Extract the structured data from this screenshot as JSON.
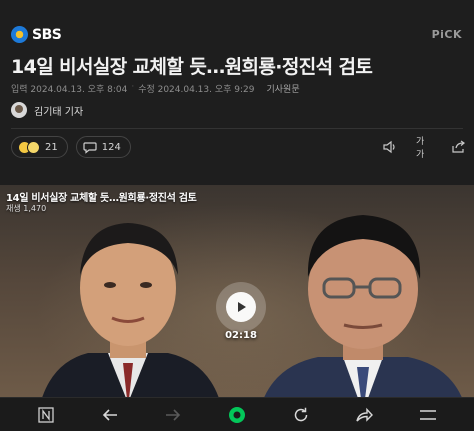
{
  "header": {
    "brand": "SBS",
    "pick_label": "PiCK"
  },
  "article": {
    "title": "14일 비서실장 교체할 듯…원희룡·정진석 검토",
    "published": "입력 2024.04.13. 오후 8:04",
    "modified": "수정 2024.04.13. 오후 9:29",
    "original_link": "기사원문",
    "reporter": "김기태 기자"
  },
  "actions": {
    "reaction_count": "21",
    "comment_count": "124",
    "font_size_label": "가가"
  },
  "video": {
    "title": "14일 비서실장 교체할 듯…원희룡·정진석 검토",
    "views": "재생 1,470",
    "duration": "02:18"
  },
  "colors": {
    "background": "#1e1e1e",
    "accent_green": "#03c75a"
  },
  "bottom_nav": [
    "naver-icon",
    "back-icon",
    "forward-icon",
    "home-icon",
    "refresh-icon",
    "share-icon",
    "menu-icon"
  ]
}
